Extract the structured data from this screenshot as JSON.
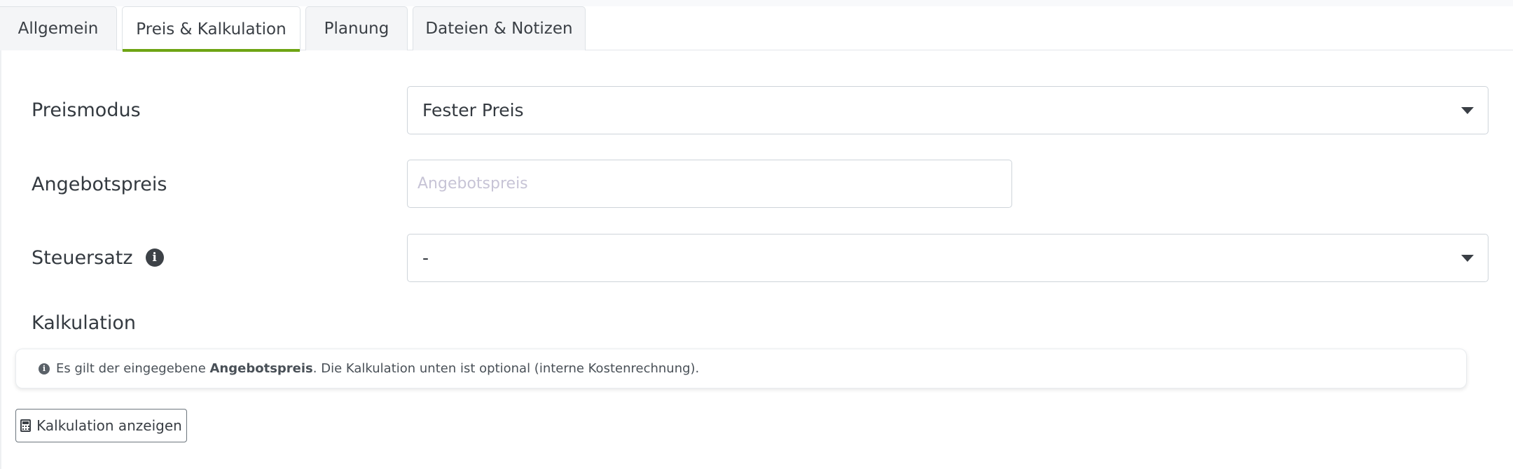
{
  "tabs": [
    {
      "label": "Allgemein",
      "active": false
    },
    {
      "label": "Preis & Kalkulation",
      "active": true
    },
    {
      "label": "Planung",
      "active": false
    },
    {
      "label": "Dateien & Notizen",
      "active": false
    }
  ],
  "accent_color": "#6ea413",
  "form": {
    "price_mode": {
      "label": "Preismodus",
      "value": "Fester Preis"
    },
    "offer_price": {
      "label": "Angebotspreis",
      "value": "",
      "placeholder": "Angebotspreis"
    },
    "tax_rate": {
      "label": "Steuersatz",
      "value": "-",
      "info_icon": "info-circle-icon"
    }
  },
  "calculation": {
    "title": "Kalkulation",
    "notice": {
      "icon": "info-circle-icon",
      "prefix": "Es gilt der eingegebene ",
      "emphasis": "Angebotspreis",
      "suffix": ". Die Kalkulation unten ist optional (interne Kostenrechnung)."
    },
    "show_button": {
      "label": "Kalkulation anzeigen",
      "icon": "calculator-icon"
    }
  }
}
